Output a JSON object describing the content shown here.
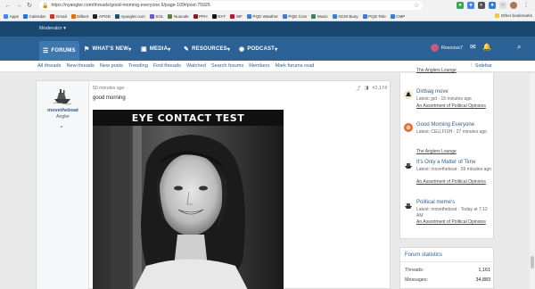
{
  "browser": {
    "url": "https://nyangler.com/threads/good-morning-everyone.6/page-109#post-75926",
    "bookmarks": [
      {
        "label": "Apps",
        "color": "#4285f4"
      },
      {
        "label": "Calendar",
        "color": "#1a73e8"
      },
      {
        "label": "Gmail",
        "color": "#d93025"
      },
      {
        "label": "Dilbert",
        "color": "#e37400"
      },
      {
        "label": "APOD",
        "color": "#222222"
      },
      {
        "label": "nyangler.com",
        "color": "#1d4f7d"
      },
      {
        "label": "SOL",
        "color": "#6a5acd"
      },
      {
        "label": "Nuscale",
        "color": "#5b7f3a"
      },
      {
        "label": "PPH",
        "color": "#8a1c1c"
      },
      {
        "label": "NYT",
        "color": "#111111"
      },
      {
        "label": "WF",
        "color": "#c8102e"
      },
      {
        "label": "PQD Weather",
        "color": "#3a7bd5"
      },
      {
        "label": "PQD Com",
        "color": "#3a7bd5"
      },
      {
        "label": "Music",
        "color": "#2e8b57"
      },
      {
        "label": "GCM Busy",
        "color": "#3a7bd5"
      },
      {
        "label": "PQD Tele",
        "color": "#3a7bd5"
      },
      {
        "label": "CMP",
        "color": "#3a7bd5"
      }
    ],
    "other_bookmarks": "Other bookmarks"
  },
  "site": {
    "moderator_label": "Moderator",
    "tabs": [
      {
        "label": "FORUMS",
        "icon": "☰",
        "active": true
      },
      {
        "label": "WHAT'S NEW",
        "icon": "⚑",
        "active": false
      },
      {
        "label": "MEDIA",
        "icon": "▣",
        "active": false
      },
      {
        "label": "RESOURCES",
        "icon": "✎",
        "active": false
      },
      {
        "label": "PODCAST",
        "icon": "◉",
        "active": false
      }
    ],
    "username": "Roscous7",
    "subnav": [
      "All threads",
      "New threads",
      "New posts",
      "Trending",
      "Find threads",
      "Watched",
      "Search forums",
      "Members",
      "Mark forums read"
    ],
    "sidebar_toggle": "Sidebar"
  },
  "post": {
    "author": "movetheboat",
    "user_title": "Angler",
    "time": "50 minutes ago",
    "post_number": "#2,174",
    "text": "good morning",
    "image_caption": "EYE CONTACT TEST"
  },
  "sidebar": {
    "threads": [
      {
        "title": "Dirtbag move",
        "meta": "Latest: jpd · 15 minutes ago",
        "forum": "An Assortment of Political Opinions"
      },
      {
        "title": "Good Morning Everyone",
        "meta": "Latest: CELLFISH · 27 minutes ago",
        "forum": "The Anglers Lounge"
      },
      {
        "title": "It's Only a Matter of Time",
        "meta": "Latest: movetheboat · 59 minutes ago",
        "forum": "An Assortment of Political Opinions"
      },
      {
        "title": "Political meme's",
        "meta": "Latest: movetheboat · Today at 7:12 AM",
        "forum": "An Assortment of Political Opinions"
      }
    ],
    "partial_top": "The Anglers Lounge",
    "stats_heading": "Forum statistics",
    "stats": [
      {
        "label": "Threads:",
        "value": "1,161"
      },
      {
        "label": "Messages:",
        "value": "34,883"
      }
    ]
  },
  "colors": {
    "header": "#1d4f7d",
    "nav": "#2b6194",
    "link": "#2b5f8f"
  }
}
